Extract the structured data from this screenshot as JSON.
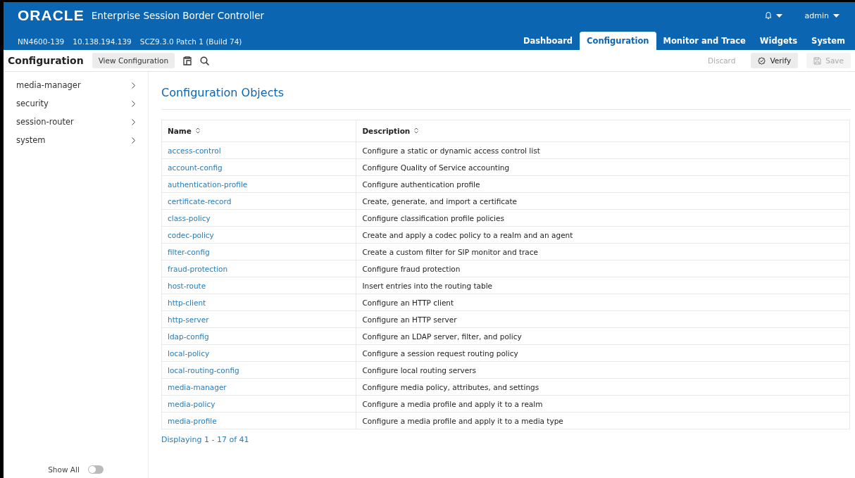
{
  "header": {
    "logo": "ORACLE",
    "product": "Enterprise Session Border Controller",
    "device": [
      "NN4600-139",
      "10.138.194.139",
      "SCZ9.3.0 Patch 1 (Build 74)"
    ],
    "user": "admin"
  },
  "tabs": [
    {
      "label": "Dashboard",
      "selected": false
    },
    {
      "label": "Configuration",
      "selected": true
    },
    {
      "label": "Monitor and Trace",
      "selected": false
    },
    {
      "label": "Widgets",
      "selected": false
    },
    {
      "label": "System",
      "selected": false
    }
  ],
  "toolbar": {
    "title": "Configuration",
    "view_button": "View Configuration",
    "actions": [
      {
        "label": "Discard",
        "disabled": true
      },
      {
        "label": "Verify",
        "disabled": false,
        "kind": "verify"
      },
      {
        "label": "Save",
        "disabled": true,
        "kind": "save"
      }
    ]
  },
  "sidebar": {
    "items": [
      {
        "label": "media-manager"
      },
      {
        "label": "security"
      },
      {
        "label": "session-router"
      },
      {
        "label": "system"
      }
    ],
    "show_all": {
      "label": "Show All",
      "on": false
    }
  },
  "panel": {
    "title": "Configuration Objects",
    "columns": [
      "Name",
      "Description"
    ],
    "rows": [
      [
        "access-control",
        "Configure a static or dynamic access control list"
      ],
      [
        "account-config",
        "Configure Quality of Service accounting"
      ],
      [
        "authentication-profile",
        "Configure authentication profile"
      ],
      [
        "certificate-record",
        "Create, generate, and import a certificate"
      ],
      [
        "class-policy",
        "Configure classification profile policies"
      ],
      [
        "codec-policy",
        "Create and apply a codec policy to a realm and an agent"
      ],
      [
        "filter-config",
        "Create a custom filter for SIP monitor and trace"
      ],
      [
        "fraud-protection",
        "Configure fraud protection"
      ],
      [
        "host-route",
        "Insert entries into the routing table"
      ],
      [
        "http-client",
        "Configure an HTTP client"
      ],
      [
        "http-server",
        "Configure an HTTP server"
      ],
      [
        "ldap-config",
        "Configure an LDAP server, filter, and policy"
      ],
      [
        "local-policy",
        "Configure a session request routing policy"
      ],
      [
        "local-routing-config",
        "Configure local routing servers"
      ],
      [
        "media-manager",
        "Configure media policy, attributes, and settings"
      ],
      [
        "media-policy",
        "Configure a media profile and apply it to a realm"
      ],
      [
        "media-profile",
        "Configure a media profile and apply it to a media type"
      ]
    ],
    "footer": "Displaying 1 - 17 of 41"
  }
}
